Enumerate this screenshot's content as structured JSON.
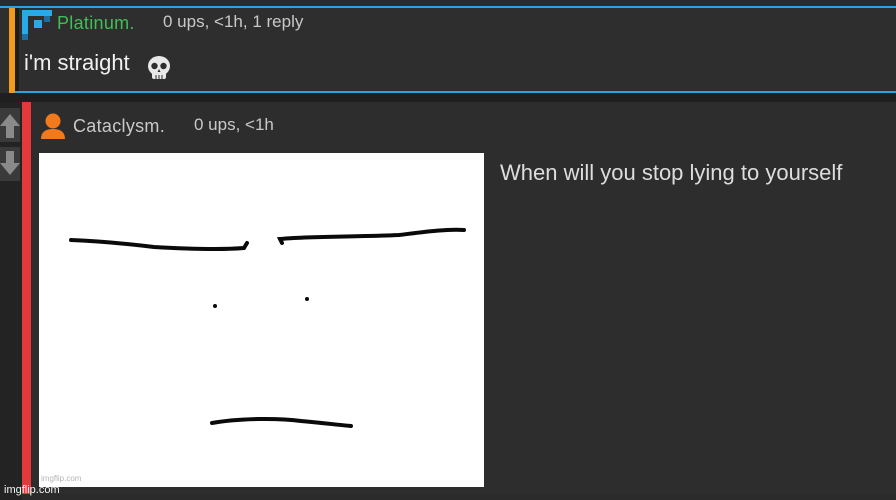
{
  "comment1": {
    "username": "Platinum.",
    "meta": "0 ups, <1h, 1 reply",
    "text": "i'm straight",
    "emoji": "skull-emoji"
  },
  "comment2": {
    "username": "Cataclysm.",
    "meta": "0 ups, <1h",
    "text": "When will you stop lying to yourself",
    "image_watermark": "imgflip.com"
  },
  "footer": {
    "watermark": "imgflip.com"
  },
  "colors": {
    "blue_rule": "#2aa4e0",
    "orange_bar": "#f29a1d",
    "red_bar": "#e5383b",
    "username_green": "#3fbf56",
    "avatar_orange": "#f27a1d"
  },
  "icons": {
    "upvote": "arrow-up-icon",
    "downvote": "arrow-down-icon",
    "user1_avatar": "pixel-avatar-icon",
    "user2_avatar": "user-silhouette-icon"
  }
}
